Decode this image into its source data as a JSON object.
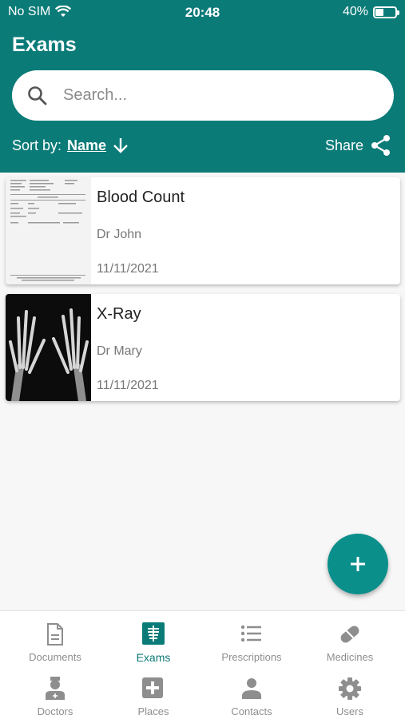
{
  "status": {
    "carrier": "No SIM",
    "time": "20:48",
    "battery": "40%",
    "battery_level": 0.4
  },
  "header": {
    "title": "Exams"
  },
  "search": {
    "placeholder": "Search...",
    "value": ""
  },
  "sort": {
    "label": "Sort by:",
    "value": "Name"
  },
  "share": {
    "label": "Share"
  },
  "exams": [
    {
      "title": "Blood Count",
      "doctor": "Dr John",
      "date": "11/11/2021"
    },
    {
      "title": "X-Ray",
      "doctor": "Dr Mary",
      "date": "11/11/2021"
    }
  ],
  "nav": {
    "items": [
      {
        "label": "Documents",
        "icon": "document-icon"
      },
      {
        "label": "Exams",
        "icon": "xray-icon",
        "active": true
      },
      {
        "label": "Prescriptions",
        "icon": "list-icon"
      },
      {
        "label": "Medicines",
        "icon": "pill-icon"
      },
      {
        "label": "Doctors",
        "icon": "doctor-icon"
      },
      {
        "label": "Places",
        "icon": "hospital-plus-icon"
      },
      {
        "label": "Contacts",
        "icon": "person-icon"
      },
      {
        "label": "Users",
        "icon": "gear-icon"
      }
    ]
  },
  "colors": {
    "primary": "#0b7b78",
    "fab": "#0b8f8b",
    "inactive": "#8e8e8e"
  }
}
